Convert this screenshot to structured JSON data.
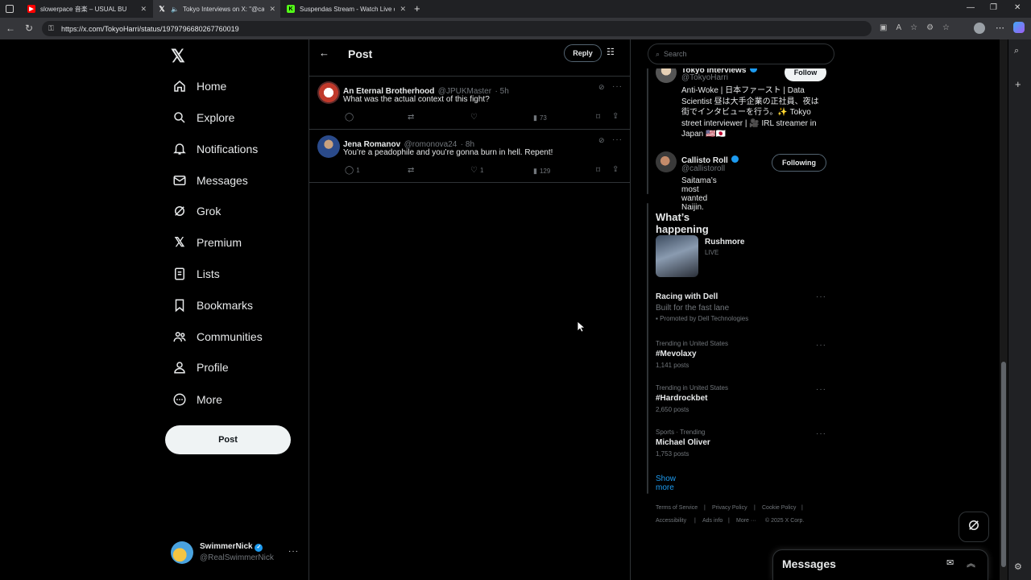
{
  "browser": {
    "tabs": [
      {
        "title": "slowerpace 音楽 – USUAL BU",
        "icon_color": "#ff0000"
      },
      {
        "title": "Tokyo Interviews on X: \"@ca",
        "icon_color": "#ffffff"
      },
      {
        "title": "Suspendas Stream - Watch Live o",
        "icon_color": "#53fc18"
      }
    ],
    "url": "https://x.com/TokyoHarri/status/1979796680267760019"
  },
  "nav": {
    "items": [
      {
        "label": "Home",
        "icon": "home-icon"
      },
      {
        "label": "Explore",
        "icon": "search-icon"
      },
      {
        "label": "Notifications",
        "icon": "bell-icon"
      },
      {
        "label": "Messages",
        "icon": "mail-icon"
      },
      {
        "label": "Grok",
        "icon": "grok-icon"
      },
      {
        "label": "Premium",
        "icon": "x-logo-icon"
      },
      {
        "label": "Lists",
        "icon": "list-icon"
      },
      {
        "label": "Bookmarks",
        "icon": "bookmark-icon"
      },
      {
        "label": "Communities",
        "icon": "people-icon"
      },
      {
        "label": "Profile",
        "icon": "person-icon"
      },
      {
        "label": "More",
        "icon": "more-circle-icon"
      }
    ],
    "post_label": "Post",
    "account": {
      "name": "SwimmerNick",
      "handle": "@RealSwimmerNick"
    }
  },
  "header": {
    "title": "Post",
    "reply_label": "Reply"
  },
  "replies": [
    {
      "name": "An Eternal Brotherhood",
      "handle": "@JPUKMaster",
      "time": "· 5h",
      "text": "What was the actual context of this fight?",
      "replies": "",
      "likes": "",
      "views": "73"
    },
    {
      "name": "Jena Romanov",
      "handle": "@romonova24",
      "time": "· 8h",
      "text": "You’re a peadophile and you’re gonna burn in hell. Repent!",
      "replies": "1",
      "likes": "1",
      "views": "129"
    }
  ],
  "search": {
    "placeholder": "Search"
  },
  "who": [
    {
      "name": "Tokyo Interviews",
      "handle": "@TokyoHarri",
      "button": "Follow",
      "bio_lines": [
        "Anti-Woke | 日本ファースト | Data",
        "Scientist 昼は大手企業の正社員、夜は",
        "街でインタビューを行う。✨ Tokyo",
        "street interviewer | 🎥 IRL streamer in",
        "Japan 🇺🇸🇯🇵"
      ]
    },
    {
      "name": "Callisto Roll",
      "handle": "@callistoroll",
      "button": "Following",
      "bio": "Saitama’s most wanted Naijin."
    }
  ],
  "happening": {
    "title": "What’s happening",
    "live": {
      "title": "Rushmore",
      "badge": "LIVE"
    },
    "promo": {
      "title": "Racing with Dell",
      "sub": "Built for the fast lane",
      "promoted": "Promoted by Dell Technologies"
    },
    "trends": [
      {
        "meta": "Trending in United States",
        "title": "#Mevolaxy",
        "posts": "1,141 posts"
      },
      {
        "meta": "Trending in United States",
        "title": "#Hardrockbet",
        "posts": "2,650 posts"
      },
      {
        "meta": "Sports · Trending",
        "title": "Michael Oliver",
        "posts": "1,753 posts"
      }
    ],
    "show_more": "Show more"
  },
  "footer": {
    "links": [
      "Terms of Service",
      "Privacy Policy",
      "Cookie Policy",
      "Accessibility",
      "Ads info",
      "More ···",
      "© 2025 X Corp."
    ]
  },
  "messages_drawer": {
    "title": "Messages"
  },
  "colors": {
    "accent": "#1d9bf0",
    "bg": "#000000",
    "border": "#2f3336"
  }
}
